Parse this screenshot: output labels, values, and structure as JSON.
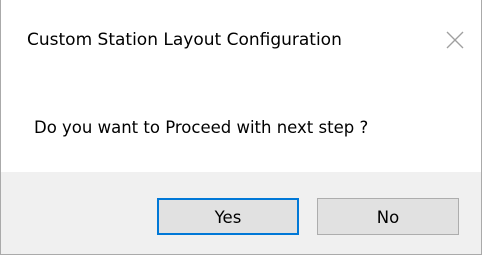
{
  "dialog": {
    "title": "Custom Station Layout Configuration",
    "message": "Do you want to Proceed with next step ?",
    "buttons": {
      "yes_label": "Yes",
      "no_label": "No"
    },
    "icons": {
      "close": "close-icon"
    },
    "colors": {
      "background": "#ffffff",
      "footer": "#f0f0f0",
      "button_face": "#e1e1e1",
      "default_button_border": "#0078d7",
      "close_glyph": "#a0a0a0"
    }
  }
}
